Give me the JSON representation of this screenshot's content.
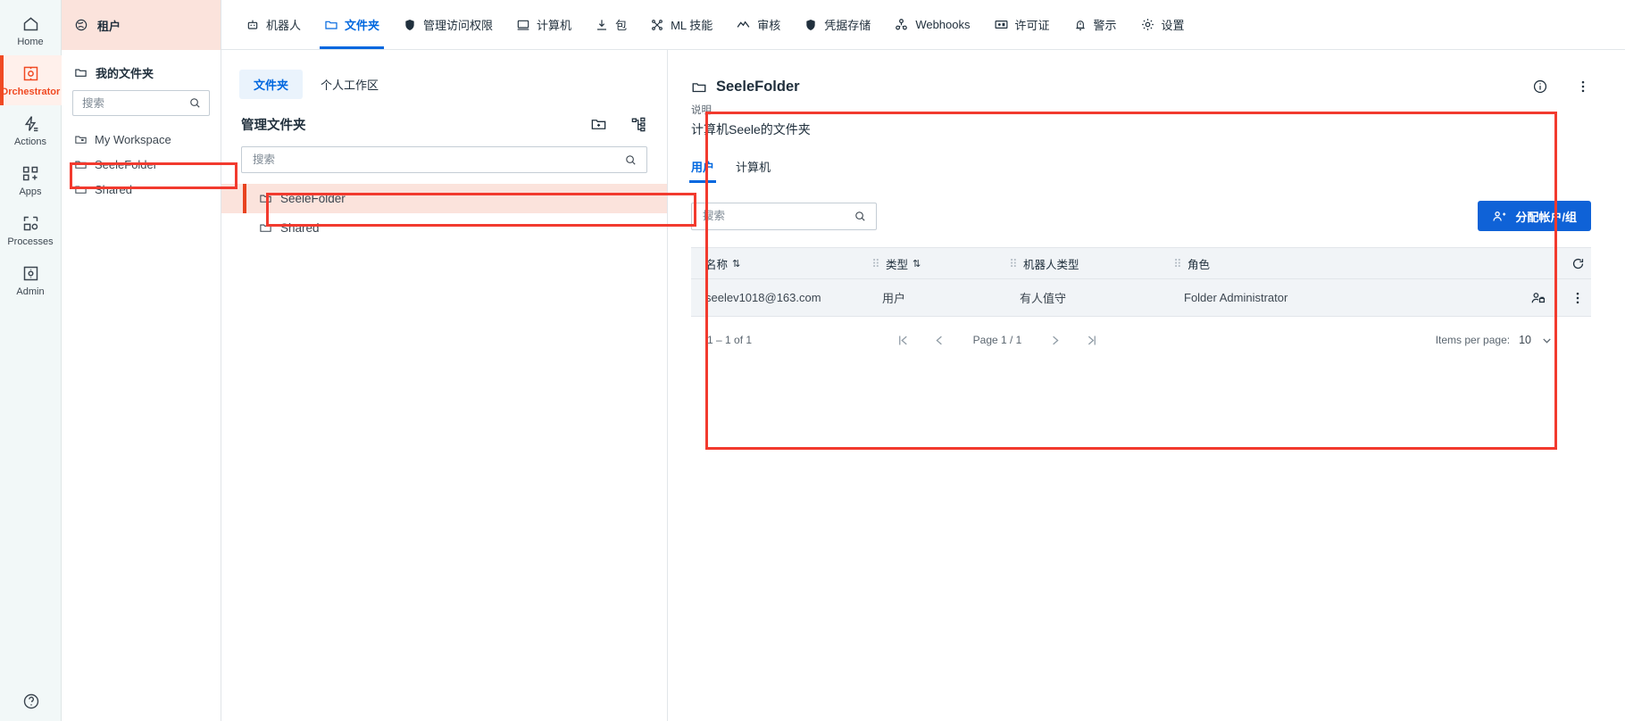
{
  "app": {
    "accent_blue": "#0067df",
    "accent_orange": "#f04a23",
    "annotation_red": "#f23a2e",
    "highlight_pink": "#fbe3dc"
  },
  "rail": {
    "items": [
      {
        "label": "Home",
        "icon": "home-icon",
        "active": false
      },
      {
        "label": "Orchestrator",
        "icon": "orchestrator-icon",
        "active": true
      },
      {
        "label": "Actions",
        "icon": "actions-icon",
        "active": false
      },
      {
        "label": "Apps",
        "icon": "apps-icon",
        "active": false
      },
      {
        "label": "Processes",
        "icon": "processes-icon",
        "active": false
      },
      {
        "label": "Admin",
        "icon": "admin-icon",
        "active": false
      }
    ],
    "help_icon": "help-circle-icon"
  },
  "sidebar": {
    "tenant_label": "租户",
    "tenant_icon": "globe-icon",
    "my_folders_label": "我的文件夹",
    "my_folders_icon": "folder-icon",
    "search_placeholder": "搜索",
    "search_value": "",
    "search_icon": "search-icon",
    "tree": [
      {
        "label": "My Workspace",
        "icon": "workspace-folder-icon"
      },
      {
        "label": "SeeleFolder",
        "icon": "folder-icon"
      },
      {
        "label": "Shared",
        "icon": "folder-icon"
      }
    ]
  },
  "topnav": {
    "tabs": [
      {
        "label": "机器人",
        "icon": "robot-icon",
        "active": false
      },
      {
        "label": "文件夹",
        "icon": "folder-icon",
        "active": true
      },
      {
        "label": "管理访问权限",
        "icon": "shield-icon",
        "active": false
      },
      {
        "label": "计算机",
        "icon": "monitor-icon",
        "active": false
      },
      {
        "label": "包",
        "icon": "download-package-icon",
        "active": false
      },
      {
        "label": "ML 技能",
        "icon": "ml-skills-icon",
        "active": false
      },
      {
        "label": "审核",
        "icon": "audit-chart-icon",
        "active": false
      },
      {
        "label": "凭据存储",
        "icon": "shield-credentials-icon",
        "active": false
      },
      {
        "label": "Webhooks",
        "icon": "webhooks-icon",
        "active": false
      },
      {
        "label": "许可证",
        "icon": "license-icon",
        "active": false
      },
      {
        "label": "警示",
        "icon": "bell-alert-icon",
        "active": false
      },
      {
        "label": "设置",
        "icon": "gear-icon",
        "active": false
      }
    ]
  },
  "left_pane": {
    "subtabs": [
      {
        "label": "文件夹",
        "active": true
      },
      {
        "label": "个人工作区",
        "active": false
      }
    ],
    "title": "管理文件夹",
    "actions": [
      {
        "name": "add-folder-icon",
        "label": "add-folder"
      },
      {
        "name": "folder-hierarchy-icon",
        "label": "folder-hierarchy"
      }
    ],
    "search_placeholder": "搜索",
    "search_value": "",
    "search_icon": "search-icon",
    "folders": [
      {
        "label": "SeeleFolder",
        "selected": true
      },
      {
        "label": "Shared",
        "selected": false
      }
    ]
  },
  "detail": {
    "title": "SeeleFolder",
    "title_icon": "folder-icon",
    "info_icon": "info-circle-icon",
    "more_icon": "more-vertical-icon",
    "description_label": "说明",
    "description_value": "计算机Seele的文件夹",
    "tabs": [
      {
        "label": "用户",
        "active": true
      },
      {
        "label": "计算机",
        "active": false
      }
    ],
    "search_placeholder": "搜索",
    "search_value": "",
    "search_icon": "search-icon",
    "assign_button_label": "分配帐户/组",
    "assign_button_icon": "assign-users-icon",
    "refresh_icon": "refresh-icon",
    "table": {
      "columns": [
        {
          "label": "名称",
          "sortable": true
        },
        {
          "label": "类型",
          "sortable": true
        },
        {
          "label": "机器人类型",
          "sortable": false
        },
        {
          "label": "角色",
          "sortable": false
        }
      ],
      "rows": [
        {
          "name": "seelev1018@163.com",
          "type": "用户",
          "robot_type": "有人值守",
          "role": "Folder Administrator",
          "row_icons": [
            "edit-user-icon",
            "more-vertical-icon"
          ]
        }
      ]
    },
    "pager": {
      "count_text": "1 – 1 of 1",
      "first_icon": "first-page-icon",
      "prev_icon": "prev-page-icon",
      "page_text": "Page 1 / 1",
      "next_icon": "next-page-icon",
      "last_icon": "last-page-icon",
      "items_per_page_label": "Items per page:",
      "items_per_page_value": "10",
      "items_per_page_chevron": "chevron-down-icon"
    }
  }
}
